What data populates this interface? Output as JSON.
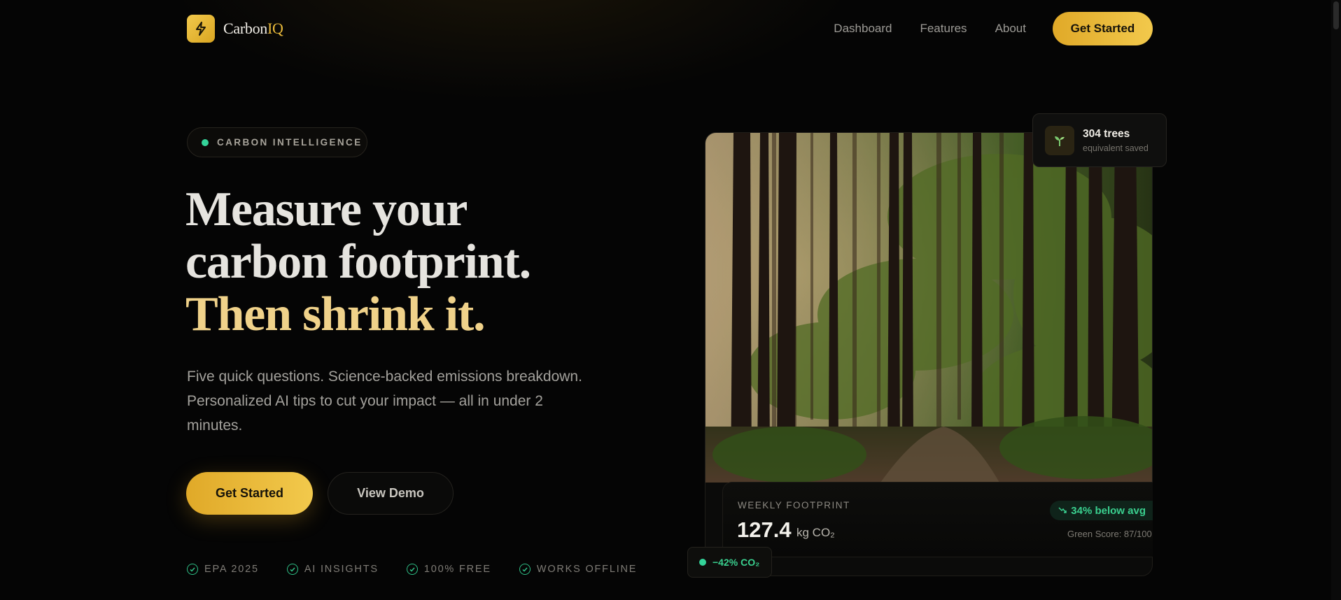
{
  "nav": {
    "brand_main": "Carbon",
    "brand_accent": "IQ",
    "links": [
      "Dashboard",
      "Features",
      "About"
    ],
    "cta": "Get Started"
  },
  "hero": {
    "badge": "CARBON INTELLIGENCE",
    "headline_1": "Measure your",
    "headline_2": "carbon footprint.",
    "headline_3": "Then shrink it.",
    "subtitle": "Five quick questions. Science-backed emissions breakdown. Personalized AI tips to cut your impact — all in under 2 minutes.",
    "primary_cta": "Get Started",
    "secondary_cta": "View Demo",
    "features": [
      "EPA 2025",
      "AI INSIGHTS",
      "100% FREE",
      "WORKS OFFLINE"
    ]
  },
  "card": {
    "image": "forest-photo",
    "footprint_label": "WEEKLY FOOTPRINT",
    "footprint_value": "127.4",
    "footprint_unit": "kg CO₂",
    "trend": "34% below avg",
    "green_score": "Green Score: 87/100",
    "reduction": "−42% CO₂",
    "trees_title": "304 trees",
    "trees_sub": "equivalent saved"
  },
  "colors": {
    "accent": "#f2c94c",
    "accent_dark": "#e0a928",
    "green": "#34d399",
    "background": "#050505"
  },
  "icons": [
    "lightning-icon",
    "check-circle-icon",
    "trend-down-icon",
    "sprout-icon"
  ]
}
